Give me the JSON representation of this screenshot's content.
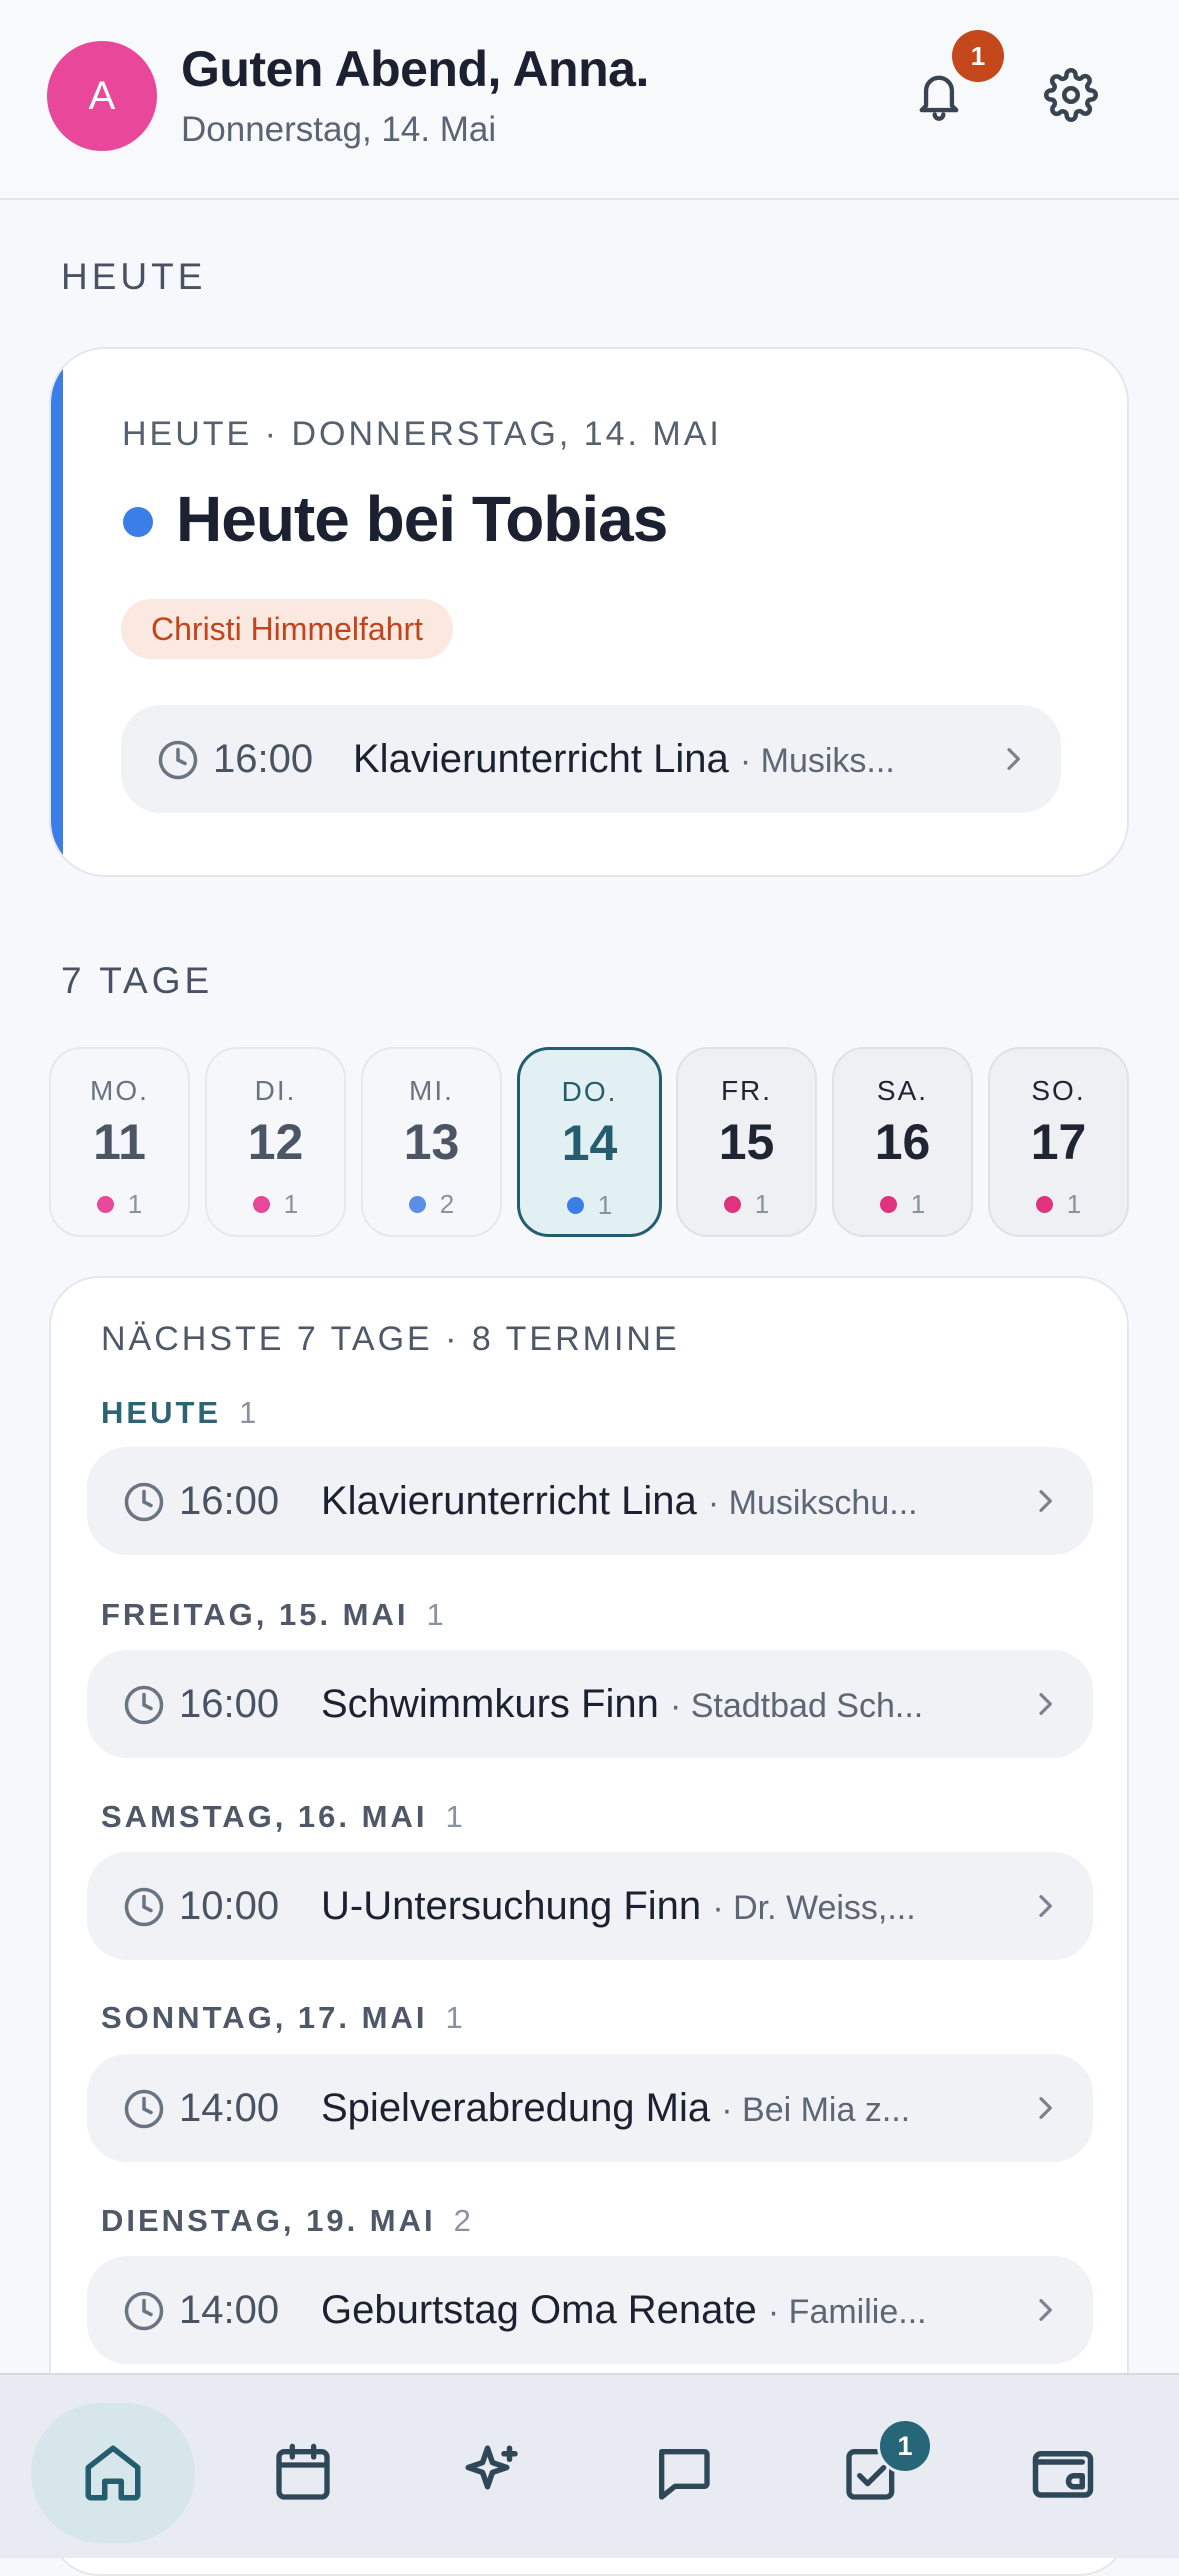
{
  "header": {
    "avatar_initial": "A",
    "greeting": "Guten Abend, Anna.",
    "date": "Donnerstag, 14. Mai",
    "notification_count": "1"
  },
  "today_section": {
    "label": "HEUTE",
    "kicker": "HEUTE · DONNERSTAG, 14. MAI",
    "title": "Heute bei Tobias",
    "holiday_tag": "Christi Himmelfahrt",
    "event": {
      "time": "16:00",
      "title": "Klavierunterricht Lina",
      "location": "· Musiks..."
    }
  },
  "week": {
    "label": "7 TAGE",
    "days": [
      {
        "name": "MO.",
        "num": "11",
        "count": "1",
        "dot_color": "#e8479a"
      },
      {
        "name": "DI.",
        "num": "12",
        "count": "1",
        "dot_color": "#e8479a"
      },
      {
        "name": "MI.",
        "num": "13",
        "count": "2",
        "dot_color": "#5b8fe6"
      },
      {
        "name": "DO.",
        "num": "14",
        "count": "1",
        "dot_color": "#3b7ee8"
      },
      {
        "name": "FR.",
        "num": "15",
        "count": "1",
        "dot_color": "#e0327e"
      },
      {
        "name": "SA.",
        "num": "16",
        "count": "1",
        "dot_color": "#e0327e"
      },
      {
        "name": "SO.",
        "num": "17",
        "count": "1",
        "dot_color": "#e0327e"
      }
    ]
  },
  "upcoming": {
    "kicker": "NÄCHSTE 7 TAGE · 8 TERMINE",
    "groups": [
      {
        "label": "HEUTE",
        "count": "1",
        "event": {
          "time": "16:00",
          "title": "Klavierunterricht Lina",
          "location": "· Musikschu..."
        }
      },
      {
        "label": "FREITAG, 15. MAI",
        "count": "1",
        "event": {
          "time": "16:00",
          "title": "Schwimmkurs Finn",
          "location": "· Stadtbad Sch..."
        }
      },
      {
        "label": "SAMSTAG, 16. MAI",
        "count": "1",
        "event": {
          "time": "10:00",
          "title": "U-Untersuchung Finn",
          "location": "· Dr. Weiss,..."
        }
      },
      {
        "label": "SONNTAG, 17. MAI",
        "count": "1",
        "event": {
          "time": "14:00",
          "title": "Spielverabredung Mia",
          "location": "· Bei Mia z..."
        }
      },
      {
        "label": "DIENSTAG, 19. MAI",
        "count": "2",
        "event": {
          "time": "14:00",
          "title": "Geburtstag Oma Renate",
          "location": "· Familie..."
        }
      }
    ]
  },
  "nav": {
    "items": [
      "home-icon",
      "calendar-icon",
      "sparkle-icon",
      "chat-icon",
      "tasks-icon",
      "wallet-icon"
    ],
    "tasks_badge": "1"
  },
  "colors": {
    "accent": "#3b7ee8",
    "teal": "#245d6d",
    "avatar": "#e8479a",
    "badge": "#c4481b"
  }
}
